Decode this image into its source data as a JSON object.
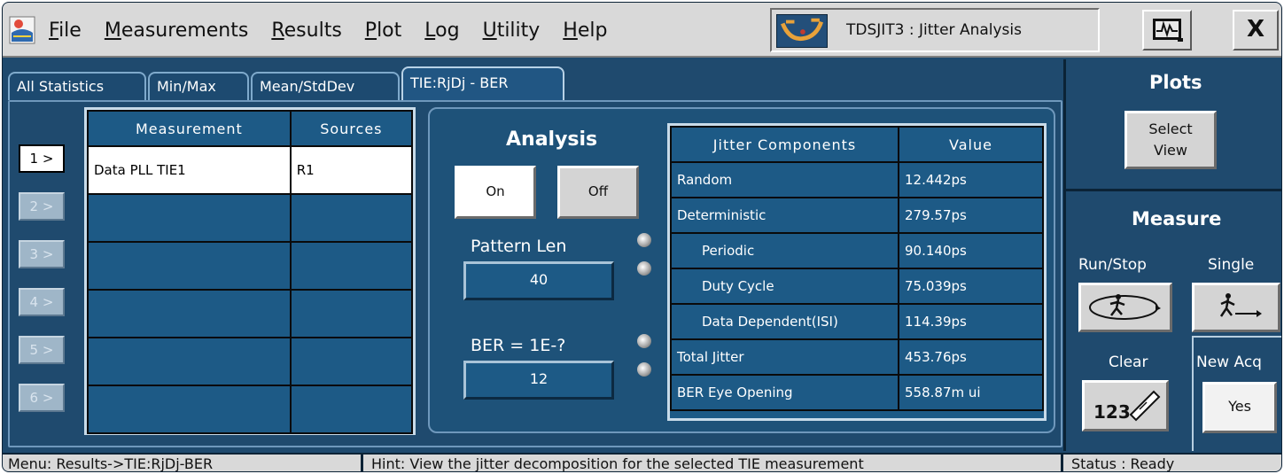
{
  "menu": {
    "items": [
      {
        "name": "menu-file",
        "label": "File",
        "underline_first": "F",
        "rest": "ile"
      },
      {
        "name": "menu-measurements",
        "label": "Measurements",
        "underline_first": "M",
        "rest": "easurements"
      },
      {
        "name": "menu-results",
        "label": "Results",
        "underline_first": "R",
        "rest": "esults"
      },
      {
        "name": "menu-plot",
        "label": "Plot",
        "underline_first": "P",
        "rest": "lot"
      },
      {
        "name": "menu-log",
        "label": "Log",
        "underline_first": "L",
        "rest": "og"
      },
      {
        "name": "menu-utility",
        "label": "Utility",
        "underline_first": "U",
        "rest": "tility"
      },
      {
        "name": "menu-help",
        "label": "Help",
        "underline_first": "H",
        "rest": "elp"
      }
    ]
  },
  "window": {
    "title": "TDSJIT3  :  Jitter Analysis",
    "close_label": "X"
  },
  "tabs": [
    {
      "label": "All Statistics",
      "active": false
    },
    {
      "label": "Min/Max",
      "active": false
    },
    {
      "label": "Mean/StdDev",
      "active": false
    },
    {
      "label": "TIE:RjDj - BER",
      "active": true
    }
  ],
  "slots": [
    {
      "label": "1 >",
      "active": true
    },
    {
      "label": "2 >",
      "active": false
    },
    {
      "label": "3 >",
      "active": false
    },
    {
      "label": "4 >",
      "active": false
    },
    {
      "label": "5 >",
      "active": false
    },
    {
      "label": "6 >",
      "active": false
    }
  ],
  "measurement_table": {
    "headers": [
      "Measurement",
      "Sources"
    ],
    "rows": [
      [
        "Data PLL TIE1",
        "R1"
      ],
      [
        "",
        ""
      ],
      [
        "",
        ""
      ],
      [
        "",
        ""
      ],
      [
        "",
        ""
      ],
      [
        "",
        ""
      ]
    ]
  },
  "analysis": {
    "title": "Analysis",
    "on_label": "On",
    "off_label": "Off",
    "pattern_len_label": "Pattern Len",
    "pattern_len_value": "40",
    "ber_label": "BER = 1E-?",
    "ber_value": "12"
  },
  "jitter_table": {
    "headers": [
      "Jitter Components",
      "Value"
    ],
    "rows": [
      {
        "name": "Random",
        "value": "12.442ps",
        "indent": false
      },
      {
        "name": "Deterministic",
        "value": "279.57ps",
        "indent": false
      },
      {
        "name": "Periodic",
        "value": "90.140ps",
        "indent": true
      },
      {
        "name": "Duty Cycle",
        "value": "75.039ps",
        "indent": true
      },
      {
        "name": "Data Dependent(ISI)",
        "value": "114.39ps",
        "indent": true
      },
      {
        "name": "Total Jitter",
        "value": "453.76ps",
        "indent": false
      },
      {
        "name": "BER Eye Opening",
        "value": "558.87m ui",
        "indent": false
      }
    ]
  },
  "right_panel": {
    "plots_title": "Plots",
    "select_view_line1": "Select",
    "select_view_line2": "View",
    "measure_title": "Measure",
    "run_stop_label": "Run/Stop",
    "single_label": "Single",
    "clear_label": "Clear",
    "new_acq_label": "New Acq",
    "yes_label": "Yes"
  },
  "status_bar": {
    "menu_path": "Menu: Results->TIE:RjDj-BER",
    "hint": "Hint: View the jitter decomposition for the selected TIE measurement",
    "status": "Status : Ready"
  },
  "colors": {
    "panel_blue": "#1f4a6e",
    "cell_blue": "#1d5a86",
    "menu_gray": "#d9d9d9"
  }
}
